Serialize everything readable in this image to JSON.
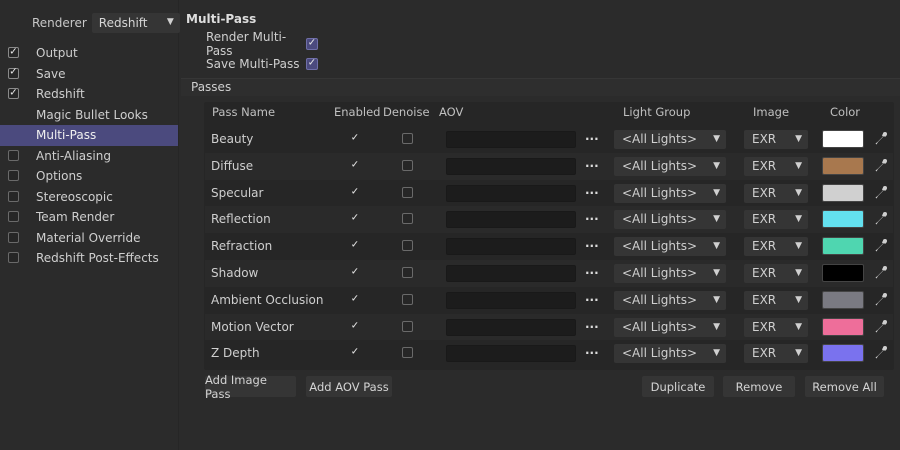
{
  "sidebar": {
    "renderer_label": "Renderer",
    "renderer_value": "Redshift",
    "items": [
      {
        "label": "Output",
        "checkbox": true,
        "checked": true,
        "active": false
      },
      {
        "label": "Save",
        "checkbox": true,
        "checked": true,
        "active": false
      },
      {
        "label": "Redshift",
        "checkbox": true,
        "checked": true,
        "active": false
      },
      {
        "label": "Magic Bullet Looks",
        "checkbox": false,
        "checked": false,
        "active": false
      },
      {
        "label": "Multi-Pass",
        "checkbox": false,
        "checked": false,
        "active": true
      },
      {
        "label": "Anti-Aliasing",
        "checkbox": true,
        "checked": false,
        "active": false
      },
      {
        "label": "Options",
        "checkbox": true,
        "checked": false,
        "active": false
      },
      {
        "label": "Stereoscopic",
        "checkbox": true,
        "checked": false,
        "active": false
      },
      {
        "label": "Team Render",
        "checkbox": true,
        "checked": false,
        "active": false
      },
      {
        "label": "Material Override",
        "checkbox": true,
        "checked": false,
        "active": false
      },
      {
        "label": "Redshift Post-Effects",
        "checkbox": true,
        "checked": false,
        "active": false
      }
    ]
  },
  "main": {
    "title": "Multi-Pass",
    "render_multipass_label": "Render Multi-Pass",
    "save_multipass_label": "Save Multi-Pass",
    "passes_label": "Passes",
    "columns": {
      "pass_name": "Pass Name",
      "enabled": "Enabled",
      "denoise": "Denoise",
      "aov": "AOV",
      "light_group": "Light Group",
      "image": "Image",
      "color": "Color"
    },
    "rows": [
      {
        "name": "Beauty",
        "light_group": "<All Lights>",
        "image": "EXR",
        "color": "#ffffff"
      },
      {
        "name": "Diffuse",
        "light_group": "<All Lights>",
        "image": "EXR",
        "color": "#a8784e"
      },
      {
        "name": "Specular",
        "light_group": "<All Lights>",
        "image": "EXR",
        "color": "#d0d0d0"
      },
      {
        "name": "Reflection",
        "light_group": "<All Lights>",
        "image": "EXR",
        "color": "#63e0ef"
      },
      {
        "name": "Refraction",
        "light_group": "<All Lights>",
        "image": "EXR",
        "color": "#4fd6b0"
      },
      {
        "name": "Shadow",
        "light_group": "<All Lights>",
        "image": "EXR",
        "color": "#000000"
      },
      {
        "name": "Ambient Occlusion",
        "light_group": "<All Lights>",
        "image": "EXR",
        "color": "#7a7a82"
      },
      {
        "name": "Motion Vector",
        "light_group": "<All Lights>",
        "image": "EXR",
        "color": "#ee6e9a"
      },
      {
        "name": "Z Depth",
        "light_group": "<All Lights>",
        "image": "EXR",
        "color": "#7a72ee"
      }
    ],
    "dots": "...",
    "buttons": {
      "add_image_pass": "Add Image Pass",
      "add_aov_pass": "Add AOV Pass",
      "duplicate": "Duplicate",
      "remove": "Remove",
      "remove_all": "Remove All"
    }
  },
  "colors": {
    "accent": "#4b4a7e",
    "background": "#2b2b2b"
  }
}
